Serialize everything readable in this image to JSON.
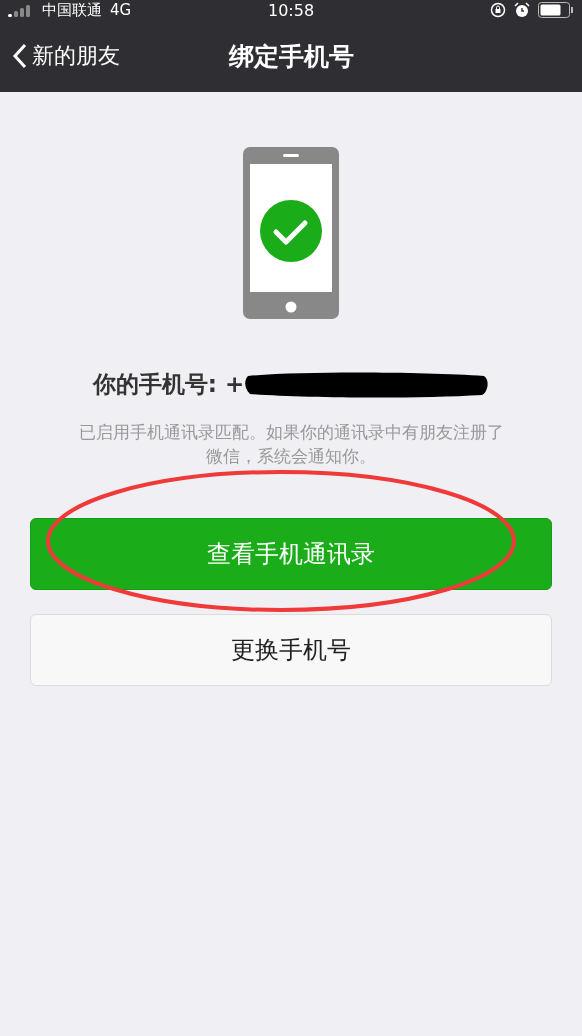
{
  "status_bar": {
    "carrier": "中国联通",
    "network": "4G",
    "time": "10:58"
  },
  "nav_bar": {
    "back_label": "新的朋友",
    "title": "绑定手机号"
  },
  "phone_label": "你的手机号: +",
  "hint": "已启用手机通讯录匹配。如果你的通讯录中有朋友注册了微信，系统会通知你。",
  "buttons": [
    {
      "label": "查看手机通讯录",
      "kind": "primary",
      "circled": true
    },
    {
      "label": "更换手机号",
      "kind": "default",
      "circled": false
    }
  ]
}
